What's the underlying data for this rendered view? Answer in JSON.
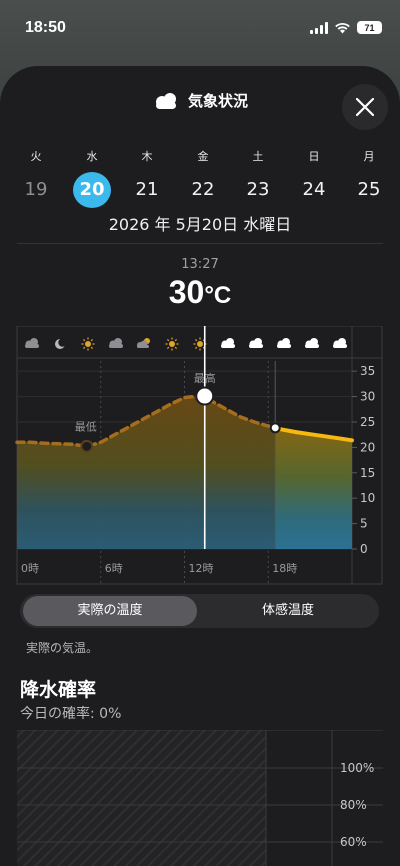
{
  "status": {
    "time": "18:50",
    "battery": "71"
  },
  "header": {
    "title": "気象状況",
    "icon": "cloud-icon"
  },
  "days": [
    {
      "weekday": "火",
      "day": "19",
      "state": "past"
    },
    {
      "weekday": "水",
      "day": "20",
      "state": "selected"
    },
    {
      "weekday": "木",
      "day": "21",
      "state": "normal"
    },
    {
      "weekday": "金",
      "day": "22",
      "state": "normal"
    },
    {
      "weekday": "土",
      "day": "23",
      "state": "normal"
    },
    {
      "weekday": "日",
      "day": "24",
      "state": "normal"
    },
    {
      "weekday": "月",
      "day": "25",
      "state": "normal"
    }
  ],
  "full_date": "2026 年 5月20日 水曜日",
  "current": {
    "time": "13:27",
    "temp": "30",
    "unit": "°C"
  },
  "toggle": {
    "actual": "実際の温度",
    "feels": "体感温度"
  },
  "description": "実際の気温。",
  "precip": {
    "title": "降水確率",
    "subtitle": "今日の確率: 0%",
    "y_ticks": [
      "100%",
      "80%",
      "60%"
    ]
  },
  "colors": {
    "accent": "#3bb8ec",
    "forecast_line": "#f5b90f",
    "history_line": "#a66d1e",
    "sheet_bg": "#1d1d1f"
  },
  "chart_data": {
    "type": "area",
    "x_label_ticks": [
      "0時",
      "6時",
      "12時",
      "18時"
    ],
    "y_ticks": [
      0,
      5,
      10,
      15,
      20,
      25,
      30,
      35
    ],
    "ylim": [
      0,
      37
    ],
    "x_range": [
      0,
      24
    ],
    "hours": [
      0,
      1,
      2,
      3,
      4,
      5,
      6,
      7,
      8,
      9,
      10,
      11,
      12,
      13,
      14,
      15,
      16,
      17,
      18,
      19,
      20,
      21,
      22,
      23,
      24
    ],
    "temps": [
      21,
      21,
      20.8,
      20.7,
      20.6,
      20.2,
      21,
      22.5,
      24,
      25.5,
      27,
      28.5,
      29.8,
      30.1,
      29,
      27.5,
      26,
      25,
      24.2,
      23.5,
      23,
      22.6,
      22.2,
      21.8,
      21.4
    ],
    "now_hour": 13.45,
    "min": {
      "label": "最低",
      "hour": 5,
      "temp": 20.2
    },
    "max": {
      "label": "最高",
      "hour": 13.45,
      "temp": 30.1
    },
    "current_marker_hour": 18.5,
    "weather_icons": [
      "cloud-icon",
      "moon-icon",
      "sun-icon",
      "cloud-icon",
      "sun-cloud-icon",
      "sun-icon",
      "sun-icon",
      "cloud-icon",
      "cloud-icon",
      "cloud-icon",
      "cloud-icon",
      "cloud-icon"
    ]
  }
}
